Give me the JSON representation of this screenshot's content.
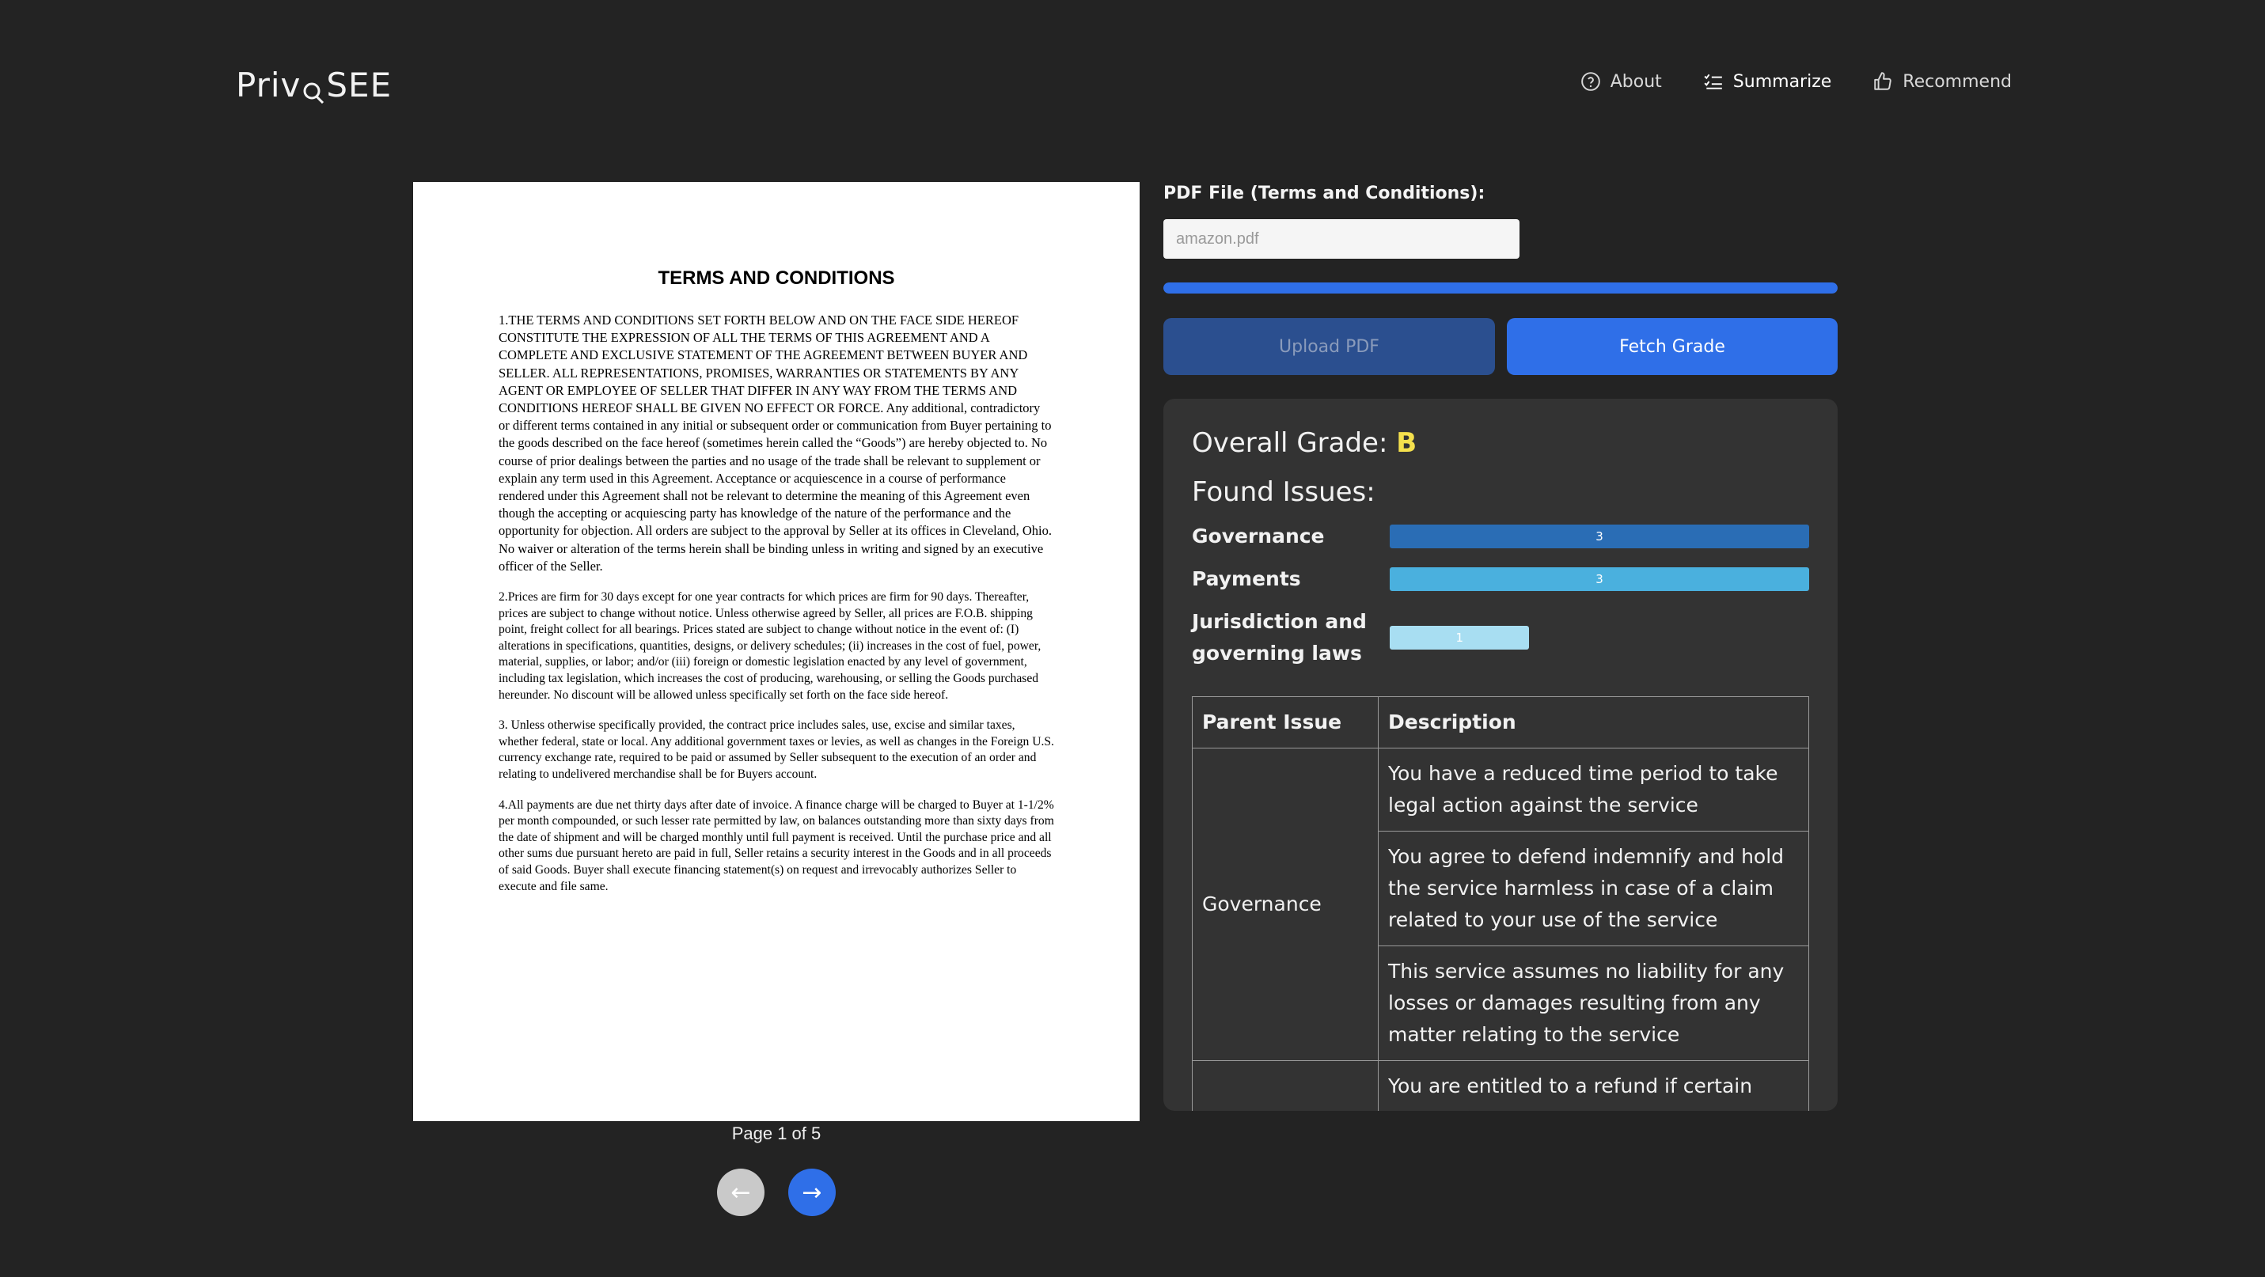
{
  "header": {
    "logo": "PrivQSEE",
    "logo_parts": [
      "Priv",
      "SEE"
    ],
    "nav": [
      {
        "label": "About",
        "icon": "help-circle-icon"
      },
      {
        "label": "Summarize",
        "icon": "checklist-icon"
      },
      {
        "label": "Recommend",
        "icon": "thumbs-up-icon"
      }
    ]
  },
  "document": {
    "title": "TERMS AND CONDITIONS",
    "paragraphs": [
      "1.THE TERMS AND CONDITIONS SET FORTH BELOW AND ON THE FACE SIDE HEREOF CONSTITUTE THE EXPRESSION OF ALL THE TERMS OF THIS AGREEMENT AND A COMPLETE AND EXCLUSIVE STATEMENT OF THE AGREEMENT BETWEEN BUYER AND SELLER. ALL REPRESENTATIONS, PROMISES, WARRANTIES OR STATEMENTS BY ANY AGENT OR EMPLOYEE OF SELLER THAT DIFFER IN ANY WAY FROM THE TERMS AND CONDITIONS HEREOF SHALL BE GIVEN NO EFFECT OR FORCE. Any additional, contradictory or different terms contained in any initial or subsequent order or communication from Buyer pertaining to the goods described on the face hereof (sometimes herein called the “Goods”) are hereby objected to. No course of prior dealings between the parties and no usage of the trade shall be relevant to supplement or explain any term used in this Agreement. Acceptance or acquiescence in a course of performance rendered under this Agreement shall not be relevant to determine the meaning of this Agreement even though the accepting or acquiescing party has knowledge of the nature of the performance and the opportunity for objection. All orders are subject to the approval by Seller at its offices in Cleveland, Ohio. No waiver or alteration of the terms herein shall be binding unless in writing and signed by an executive officer of the Seller.",
      "2.Prices are firm for 30 days except for one year contracts for which prices are firm for 90 days. Thereafter, prices are subject to change without notice. Unless otherwise agreed by Seller, all prices are F.O.B. shipping point, freight collect for all bearings. Prices stated are subject to change without notice in the event of: (I) alterations in specifications, quantities, designs, or delivery schedules; (ii) increases in the cost of fuel, power, material, supplies, or labor; and/or (iii) foreign or domestic legislation enacted by any level of government, including tax legislation, which increases the cost of producing, warehousing, or selling the Goods purchased hereunder. No discount will be allowed unless specifically set forth on the face side hereof.",
      "3. Unless otherwise specifically provided, the contract price includes sales, use, excise and similar taxes, whether federal, state or local. Any additional government taxes or levies, as well as changes in the Foreign U.S. currency exchange rate, required to be paid or assumed by Seller subsequent to the execution of an order and relating to undelivered merchandise shall be for Buyers account.",
      "4.All payments are due net thirty days after date of invoice. A finance charge will be charged to Buyer at 1-1/2% per month compounded, or such lesser rate permitted by law, on balances outstanding more than sixty days from the date of shipment and will be charged monthly until full payment is received. Until the purchase price and all other sums due pursuant hereto are paid in full, Seller retains a security interest in the Goods and in all proceeds of said Goods. Buyer shall execute financing statement(s) on request and irrevocably authorizes Seller to execute and file same."
    ],
    "page_indicator": "Page 1 of 5",
    "prev_label": "←",
    "next_label": "→"
  },
  "upload": {
    "label": "PDF File (Terms and Conditions):",
    "file_value": "amazon.pdf",
    "progress": 1.0,
    "upload_button": "Upload PDF",
    "fetch_button": "Fetch Grade"
  },
  "results": {
    "grade_label": "Overall Grade:",
    "grade_value": "B",
    "found_issues_label": "Found Issues:",
    "issues": [
      {
        "label": "Governance",
        "count": "3",
        "fraction": 1.0,
        "color": "#2a6db5"
      },
      {
        "label": "Payments",
        "count": "3",
        "fraction": 1.0,
        "color": "#4ab0de"
      },
      {
        "label": "Jurisdiction and governing laws",
        "count": "1",
        "fraction": 0.333,
        "color": "#a8def2"
      }
    ],
    "table": {
      "headers": [
        "Parent Issue",
        "Description"
      ],
      "parent_issue": "Governance",
      "rows": [
        "You have a reduced time period to take legal action against the service",
        "You agree to defend indemnify and hold the service harmless in case of a claim related to your use of the service",
        "This service assumes no liability for any losses or damages resulting from any matter relating to the service",
        "You are entitled to a refund if certain"
      ]
    }
  },
  "colors": {
    "background": "#232323",
    "accent": "#2f6fe8",
    "grade": "#f4e04d"
  }
}
